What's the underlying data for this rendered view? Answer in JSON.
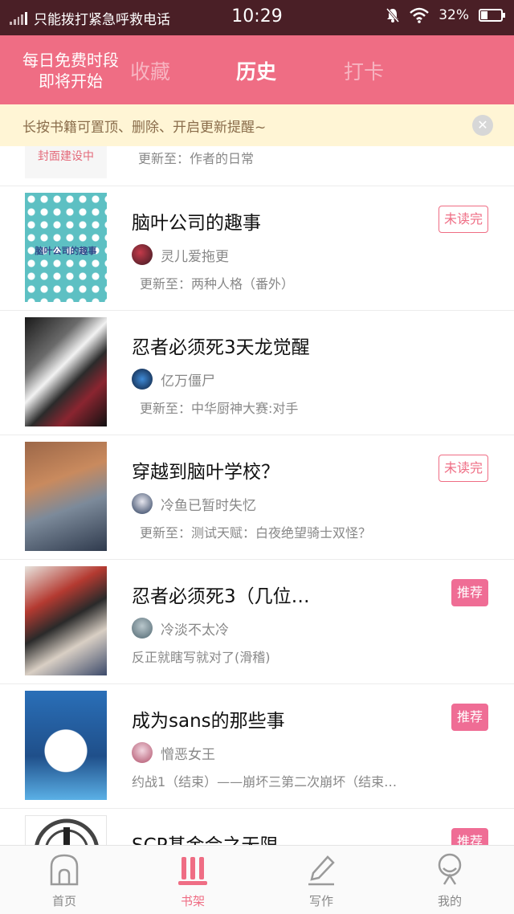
{
  "status_bar": {
    "carrier": "只能拨打紧急呼救电话",
    "time": "10:29",
    "battery": "32%",
    "battery_level": 0.32
  },
  "header": {
    "promo_line1": "每日免费时段",
    "promo_line2": "即将开始",
    "tabs": [
      {
        "label": "收藏",
        "active": false
      },
      {
        "label": "历史",
        "active": true
      },
      {
        "label": "打卡",
        "active": false
      }
    ]
  },
  "notice": {
    "text": "长按书籍可置顶、删除、开启更新提醒~",
    "close_icon": "close-icon"
  },
  "partial_item": {
    "cover_text": "封面建设中",
    "update": "更新至：作者的日常"
  },
  "books": [
    {
      "title": "脑叶公司的趣事",
      "author": "灵儿爱拖更",
      "update": "更新至：两种人格（番外）",
      "badge": "未读完",
      "cover_text": "脑叶公司的趣事"
    },
    {
      "title": "忍者必须死3天龙觉醒",
      "author": "亿万僵尸",
      "update": "更新至：中华厨神大赛:对手",
      "badge": ""
    },
    {
      "title": "穿越到脑叶学校？",
      "author": "冷鱼已暂时失忆",
      "update": "更新至：测试天赋：白夜绝望骑士双怪？",
      "badge": "未读完"
    },
    {
      "title": "忍者必须死3（几位…",
      "author": "冷淡不太冷",
      "update": "反正就瞎写就对了(滑稽)",
      "badge": "推荐"
    },
    {
      "title": "成为sans的那些事",
      "author": "憎恶女王",
      "update": "约战1（结束）——崩坏三第二次崩坏（结束…",
      "badge": "推荐"
    },
    {
      "title": "SCP基金会之无限",
      "badge": "推荐"
    }
  ],
  "bottom_nav": [
    {
      "label": "首页",
      "icon": "home-icon"
    },
    {
      "label": "书架",
      "icon": "bookshelf-icon",
      "active": true
    },
    {
      "label": "写作",
      "icon": "pen-icon"
    },
    {
      "label": "我的",
      "icon": "profile-icon"
    }
  ],
  "colors": {
    "accent": "#ef6d84",
    "status_bar": "#4a1f26",
    "notice_bg": "#fff5d5"
  }
}
